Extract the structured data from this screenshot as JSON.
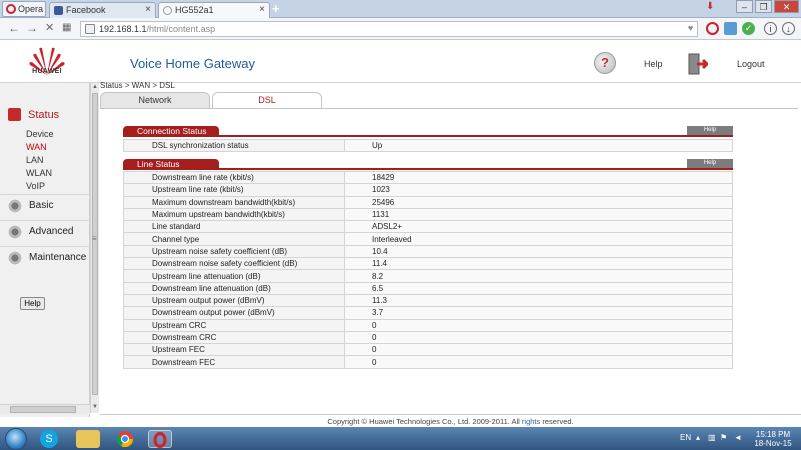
{
  "browser": {
    "menu_label": "Opera",
    "tabs": [
      {
        "label": "Facebook",
        "favicon_color": "#3b5998"
      },
      {
        "label": "HG552a1",
        "favicon_color": "#888888"
      }
    ],
    "new_tab": "+",
    "address": {
      "host": "192.168.1.1",
      "path": "/html/content.asp"
    }
  },
  "header": {
    "logo_text": "HUAWEI",
    "title": "Voice Home Gateway",
    "help": "Help",
    "logout": "Logout"
  },
  "sidebar": {
    "status": {
      "label": "Status",
      "items": [
        "Device",
        "WAN",
        "LAN",
        "WLAN",
        "VoIP"
      ],
      "active": "WAN"
    },
    "groups": [
      "Basic",
      "Advanced",
      "Maintenance"
    ],
    "help_button": "Help"
  },
  "breadcrumb": "Status > WAN > DSL",
  "tabs": {
    "network": "Network",
    "dsl": "DSL"
  },
  "connection_status": {
    "title": "Connection Status",
    "help": "Help",
    "rows": [
      {
        "label": "DSL synchronization status",
        "value": "Up"
      }
    ]
  },
  "line_status": {
    "title": "Line Status",
    "help": "Help",
    "rows": [
      {
        "label": "Downstream line rate (kbit/s)",
        "value": "18429"
      },
      {
        "label": "Upstream line rate (kbit/s)",
        "value": "1023"
      },
      {
        "label": "Maximum downstream bandwidth(kbit/s)",
        "value": "25496"
      },
      {
        "label": "Maximum upstream bandwidth(kbit/s)",
        "value": "1131"
      },
      {
        "label": "Line standard",
        "value": "ADSL2+"
      },
      {
        "label": "Channel type",
        "value": "Interleaved"
      },
      {
        "label": "Upstream noise safety coefficient (dB)",
        "value": "10.4"
      },
      {
        "label": "Downstream noise safety coefficient (dB)",
        "value": "11.4"
      },
      {
        "label": "Upstream line attenuation (dB)",
        "value": "8.2"
      },
      {
        "label": "Downstream line attenuation (dB)",
        "value": "6.5"
      },
      {
        "label": "Upstream output power (dBmV)",
        "value": "11.3"
      },
      {
        "label": "Downstream output power (dBmV)",
        "value": "3.7"
      },
      {
        "label": "Upstream CRC",
        "value": "0"
      },
      {
        "label": "Downstream CRC",
        "value": "0"
      },
      {
        "label": "Upstream FEC",
        "value": "0"
      },
      {
        "label": "Downstream FEC",
        "value": "0"
      }
    ]
  },
  "footer": {
    "text": "Copyright © Huawei Technologies Co., Ltd. 2009-2011. All",
    "rights": "rights",
    "end": "reserved."
  },
  "taskbar": {
    "language": "EN",
    "time": "15:18 PM",
    "date": "18-Nov-15"
  },
  "colors": {
    "brand_red": "#a41e1e",
    "title_blue": "#1d5c95"
  }
}
